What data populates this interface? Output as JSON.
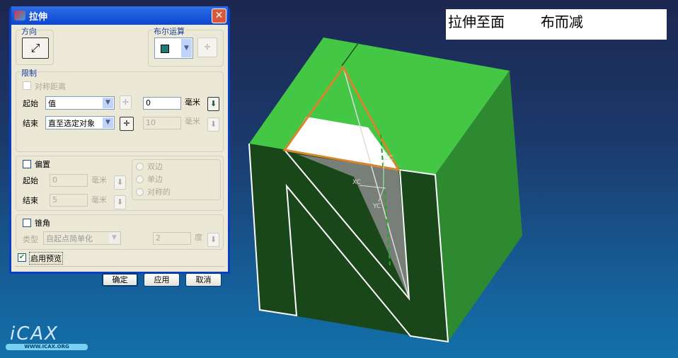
{
  "dialog": {
    "title": "拉伸",
    "close": "✕",
    "direction": {
      "label": "方向"
    },
    "boolean": {
      "label": "布尔运算"
    },
    "limits": {
      "label": "限制",
      "symmetric": "对称距离",
      "start_label": "起始",
      "start_type": "值",
      "start_value": "0",
      "start_unit": "毫米",
      "end_label": "结束",
      "end_type": "直至选定对象",
      "end_value": "10",
      "end_unit": "毫米"
    },
    "offset": {
      "label": "偏置",
      "start_label": "起始",
      "start_value": "0",
      "start_unit": "毫米",
      "end_label": "结束",
      "end_value": "5",
      "end_unit": "毫米",
      "options": [
        "双边",
        "单边",
        "对称的"
      ]
    },
    "draft": {
      "label": "锥角",
      "type_label": "类型",
      "type_value": "自起点简单化",
      "angle": "2",
      "unit": "度"
    },
    "preview": {
      "label": "启用预览",
      "checked": true
    },
    "buttons": {
      "ok": "确定",
      "apply": "应用",
      "cancel": "取消"
    }
  },
  "note": {
    "text": "拉伸至面        布而减"
  },
  "viewport": {
    "axes": {
      "x": "XC",
      "y": "YC",
      "z": "ZC"
    }
  },
  "logo": {
    "text": "iCAX",
    "url": "WWW.ICAX.ORG"
  },
  "colors": {
    "top": "#44c744",
    "front": "#19471a",
    "side": "#2e8a30",
    "sketch": "#d8862c"
  }
}
